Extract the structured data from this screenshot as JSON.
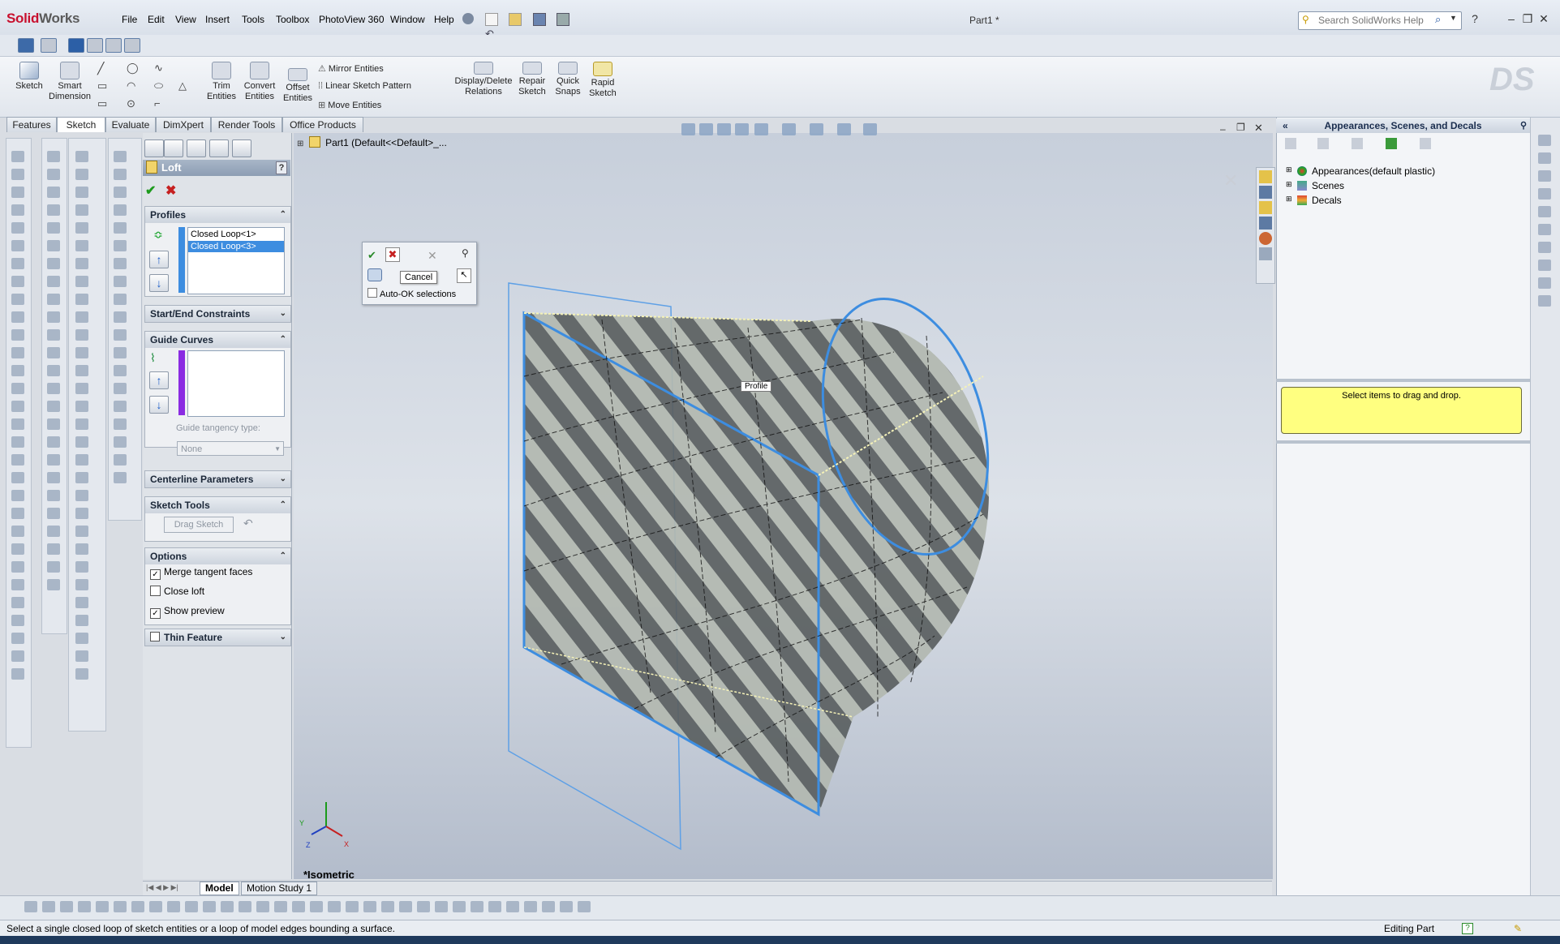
{
  "app": {
    "logo_brand": "Solid",
    "logo_rest": "Works",
    "menu": [
      "File",
      "Edit",
      "View",
      "Insert",
      "Tools",
      "Toolbox",
      "PhotoView 360",
      "Window",
      "Help"
    ],
    "title": "Part1 *",
    "help_search_placeholder": "Search SolidWorks Help"
  },
  "commandmanager": {
    "sketch": "Sketch",
    "smart_dim_1": "Smart",
    "smart_dim_2": "Dimension",
    "trim_1": "Trim",
    "trim_2": "Entities",
    "convert_1": "Convert",
    "convert_2": "Entities",
    "offset_1": "Offset",
    "offset_2": "Entities",
    "mirror": "Mirror Entities",
    "linear_pattern": "Linear Sketch Pattern",
    "move": "Move Entities",
    "display_1": "Display/Delete",
    "display_2": "Relations",
    "repair_1": "Repair",
    "repair_2": "Sketch",
    "quick_1": "Quick",
    "quick_2": "Snaps",
    "rapid_1": "Rapid",
    "rapid_2": "Sketch"
  },
  "tabs": [
    "Features",
    "Sketch",
    "Evaluate",
    "DimXpert",
    "Render Tools",
    "Office Products"
  ],
  "loft": {
    "title": "Loft",
    "help": "?",
    "profiles": {
      "header": "Profiles",
      "items": [
        "Closed Loop<1>",
        "Closed Loop<3>"
      ]
    },
    "start_end": "Start/End Constraints",
    "guide_curves": "Guide Curves",
    "guide_tangency_label": "Guide tangency type:",
    "guide_tangency_value": "None",
    "centerline": "Centerline Parameters",
    "sketch_tools": "Sketch Tools",
    "drag_sketch": "Drag Sketch",
    "options": {
      "header": "Options",
      "merge": "Merge tangent faces",
      "close": "Close loft",
      "preview": "Show preview",
      "merge_checked": true,
      "close_checked": false,
      "preview_checked": true
    },
    "thin": "Thin Feature"
  },
  "viewport": {
    "tree_label": "Part1  (Default<<Default>_...",
    "popup_auto_ok": "Auto-OK selections",
    "cancel_tooltip": "Cancel",
    "profile_tooltip": "Profile",
    "view_label": "*Isometric",
    "axis_x": "X",
    "axis_y": "Y",
    "axis_z": "Z"
  },
  "taskpane": {
    "title": "Appearances, Scenes, and Decals",
    "items": [
      "Appearances(default plastic)",
      "Scenes",
      "Decals"
    ],
    "drag_hint": "Select items to drag and drop."
  },
  "bottom": {
    "tabs": [
      "Model",
      "Motion Study 1"
    ]
  },
  "status": {
    "message": "Select a single closed loop of sketch entities or a loop of model edges bounding a surface.",
    "mode": "Editing Part",
    "help_icon": "?"
  },
  "colors": {
    "selection_blue": "#3d8de0",
    "guide_purple": "#8a2be2",
    "hint_yellow": "#ffff80"
  }
}
